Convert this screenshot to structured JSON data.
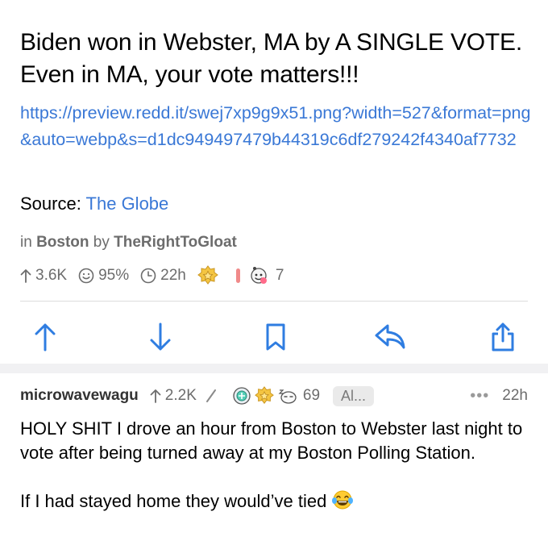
{
  "post": {
    "title": "Biden won in Webster, MA by A SINGLE VOTE. Even in MA, your vote matters!!!",
    "link": "https://preview.redd.it/swej7xp9g9x51.png?width=527&format=png&auto=webp&s=d1dc949497479b44319c6df279242f4340af7732",
    "source_label": "Source:",
    "source_link": "The Globe",
    "meta_in": "in",
    "subreddit": "Boston",
    "meta_by": "by",
    "author": "TheRightToGloat",
    "upvotes": "3.6K",
    "upvote_ratio": "95%",
    "age": "22h",
    "award_count": "7"
  },
  "actions": {
    "upvote": "upvote",
    "downvote": "downvote",
    "save": "save",
    "reply": "reply",
    "share": "share"
  },
  "comment": {
    "author": "microwavewagu",
    "score": "2.2K",
    "award_count": "69",
    "flair": "Al...",
    "more": "•••",
    "age": "22h",
    "paragraph_1": "HOLY SHIT I drove an hour from Boston to Webster last night to vote after being turned away at my Boston Polling Station.",
    "paragraph_2": "If I had stayed home they would’ve tied"
  },
  "colors": {
    "link": "#3a78d6",
    "action_blue": "#2f7de1",
    "meta_gray": "#6c6c6c"
  }
}
